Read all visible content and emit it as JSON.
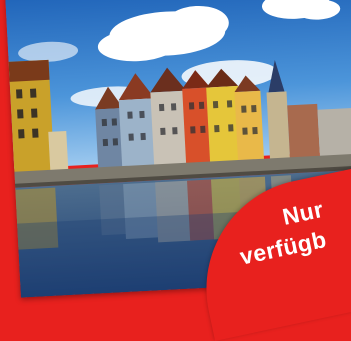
{
  "image": {
    "description_free": true,
    "colors": {
      "frame": "#e8211e",
      "sky": "#2f7fd0",
      "water": "#27508a"
    }
  },
  "promo": {
    "line1": "Nur",
    "line2": "verfügb"
  }
}
